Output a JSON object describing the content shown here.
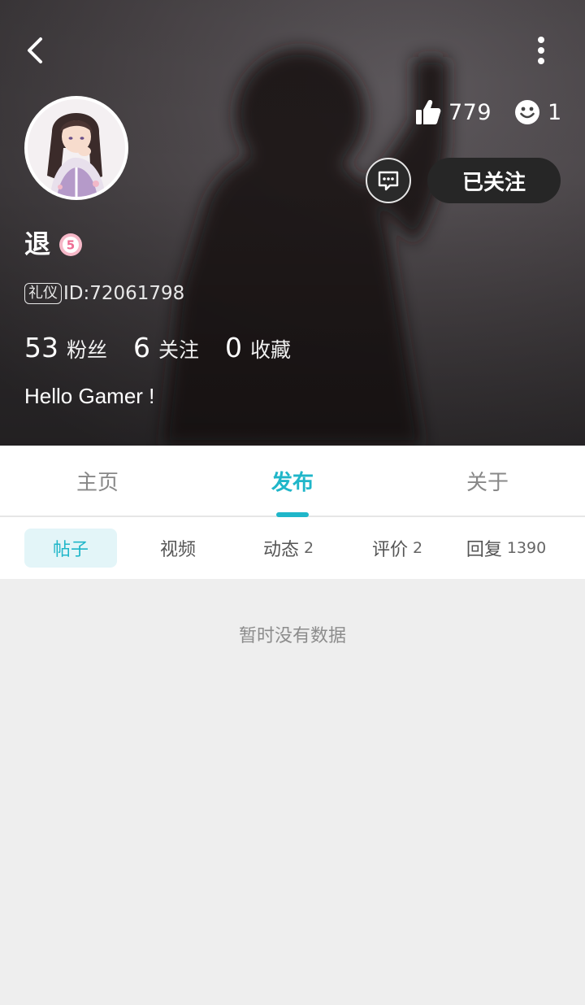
{
  "header": {
    "back_icon": "chevron-left-icon",
    "more_icon": "more-vertical-icon",
    "likes": "779",
    "smiles": "1",
    "follow_label": "已关注",
    "username": "退",
    "level": "5",
    "id_tag": "礼仪",
    "id_text": "ID:72061798",
    "counts": [
      {
        "num": "53",
        "label": "粉丝"
      },
      {
        "num": "6",
        "label": "关注"
      },
      {
        "num": "0",
        "label": "收藏"
      }
    ],
    "bio": "Hello Gamer !"
  },
  "main_tabs": [
    {
      "label": "主页"
    },
    {
      "label": "发布"
    },
    {
      "label": "关于"
    }
  ],
  "sub_tabs": [
    {
      "label": "帖子",
      "count": ""
    },
    {
      "label": "视频",
      "count": ""
    },
    {
      "label": "动态",
      "count": "2"
    },
    {
      "label": "评价",
      "count": "2"
    },
    {
      "label": "回复",
      "count": "1390"
    }
  ],
  "empty_text": "暂时没有数据",
  "colors": {
    "accent": "#1fb6c9",
    "page_bg": "#eeeeee"
  }
}
